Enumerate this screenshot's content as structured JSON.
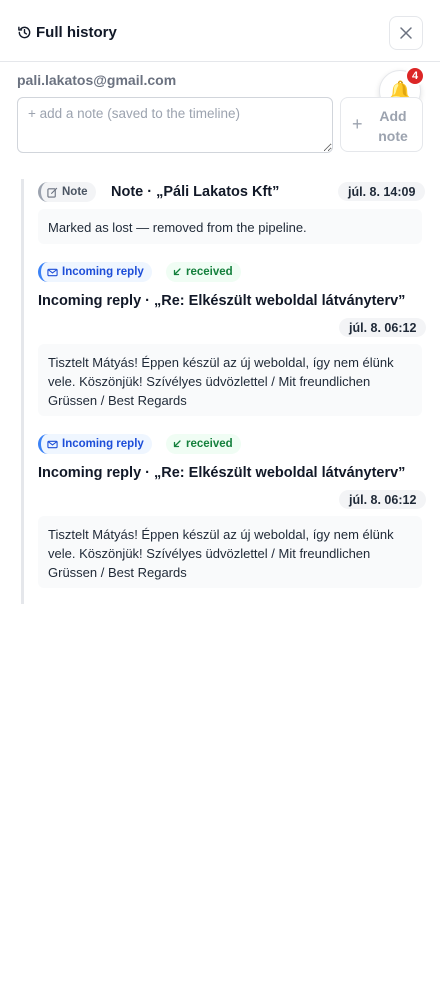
{
  "header": {
    "title": "Full history",
    "history_icon": "history-icon",
    "close_icon": "close-icon"
  },
  "contact": {
    "email": "pali.lakatos@gmail.com"
  },
  "notifications": {
    "count": "4",
    "icon": "bell-icon"
  },
  "composer": {
    "placeholder": "+ add a note (saved to the timeline)",
    "value": "",
    "add_plus": "+",
    "add_label": "Add note"
  },
  "entries": [
    {
      "kind_label": "Note",
      "kind_icon": "edit-icon",
      "title": "Note · „Páli Lakatos Kft”",
      "time": "júl. 8. 14:09",
      "body": "Marked as lost — removed from the pipeline."
    },
    {
      "kind_label": "Incoming reply",
      "kind_icon": "mail-icon",
      "status_label": "received",
      "status_icon": "arrow-down-left-icon",
      "title": "Incoming reply · „Re: Elkészült weboldal látványterv”",
      "time": "júl. 8. 06:12",
      "body": "Tisztelt Mátyás! Éppen készül az új weboldal, így nem élünk vele. Köszönjük! Szívélyes üdvözlettel / Mit freundlichen Grüssen / Best Regards"
    },
    {
      "kind_label": "Incoming reply",
      "kind_icon": "mail-icon",
      "status_label": "received",
      "status_icon": "arrow-down-left-icon",
      "title": "Incoming reply · „Re: Elkészült weboldal látványterv”",
      "time": "júl. 8. 06:12",
      "body": "Tisztelt Mátyás! Éppen készül az új weboldal, így nem élünk vele. Köszönjük! Szívélyes üdvözlettel / Mit freundlichen Grüssen / Best Regards"
    }
  ],
  "colors": {
    "accent_blue": "#1d4ed8",
    "received_green": "#15803d",
    "badge_red": "#dc2626"
  }
}
